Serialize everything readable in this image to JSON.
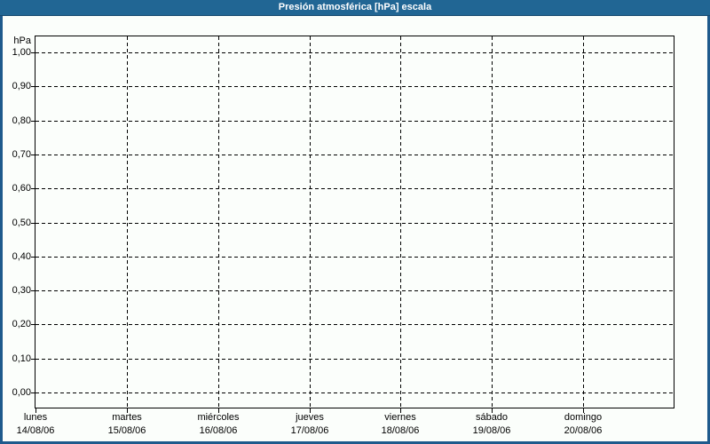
{
  "window": {
    "title": "Presión atmosférica [hPa] escala"
  },
  "colors": {
    "titlebar_bg": "#216694",
    "titlebar_text": "#ffffff",
    "frame_border": "#1e5a8c",
    "panel_background": "#fbfefb",
    "grid_line": "#000000",
    "label_text": "#000000"
  },
  "chart_data": {
    "type": "line",
    "title": "Presión atmosférica [hPa] escala",
    "xlabel": "",
    "ylabel": "hPa",
    "ylim": [
      0.0,
      1.0
    ],
    "y_tick_step": 0.1,
    "y_tick_labels": [
      "1,00",
      "0,90",
      "0,80",
      "0,70",
      "0,60",
      "0,50",
      "0,40",
      "0,30",
      "0,20",
      "0,10",
      "0,00"
    ],
    "x_categories": [
      {
        "day": "lunes",
        "date": "14/08/06"
      },
      {
        "day": "martes",
        "date": "15/08/06"
      },
      {
        "day": "miércoles",
        "date": "16/08/06"
      },
      {
        "day": "jueves",
        "date": "17/08/06"
      },
      {
        "day": "viernes",
        "date": "18/08/06"
      },
      {
        "day": "sábado",
        "date": "19/08/06"
      },
      {
        "day": "domingo",
        "date": "20/08/06"
      }
    ],
    "series": [],
    "grid": "dashed",
    "legend": "none"
  }
}
